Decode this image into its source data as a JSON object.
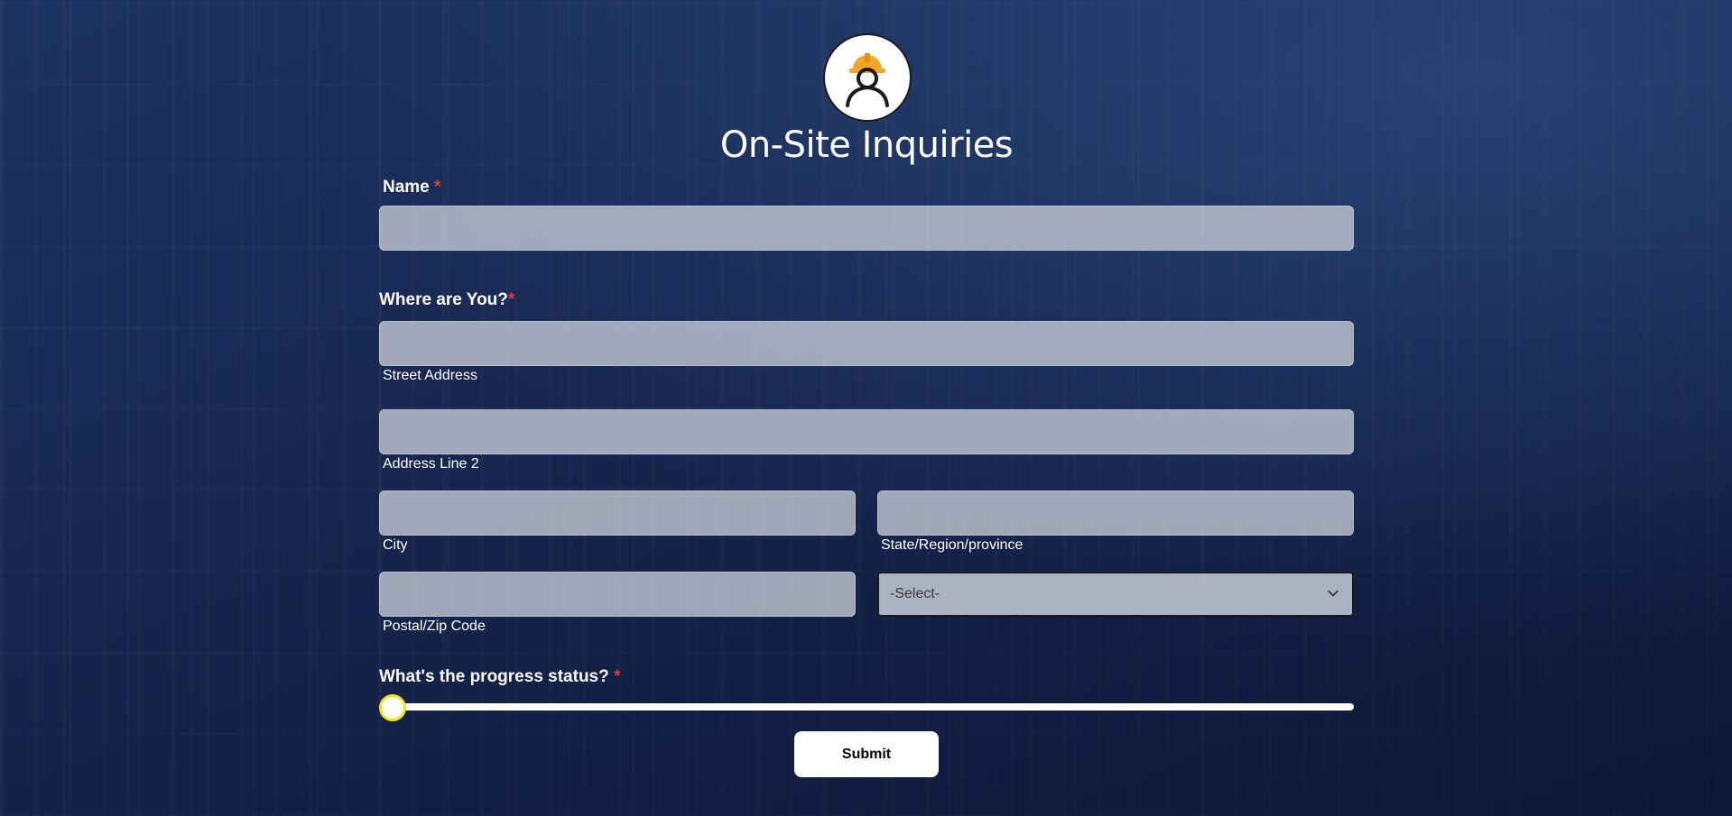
{
  "form": {
    "title": "On-Site Inquiries",
    "name_label": "Name",
    "location_label": "Where are You?",
    "required_mark": "*",
    "street_value": "",
    "street_sublabel": "Street Address",
    "address2_value": "",
    "address2_sublabel": "Address Line 2",
    "city_value": "",
    "city_sublabel": "City",
    "state_value": "",
    "state_sublabel": "State/Region/province",
    "postal_value": "",
    "postal_sublabel": "Postal/Zip Code",
    "country_select_value": "-Select-",
    "progress_label": "What's the progress status?",
    "progress_value": 0,
    "submit_label": "Submit"
  },
  "icons": {
    "avatar": "construction-worker-icon",
    "select": "chevron-down-icon"
  },
  "colors": {
    "required": "#e03a3a",
    "hardhat": "#f5a623",
    "slider_thumb_border": "#f4e31a"
  }
}
